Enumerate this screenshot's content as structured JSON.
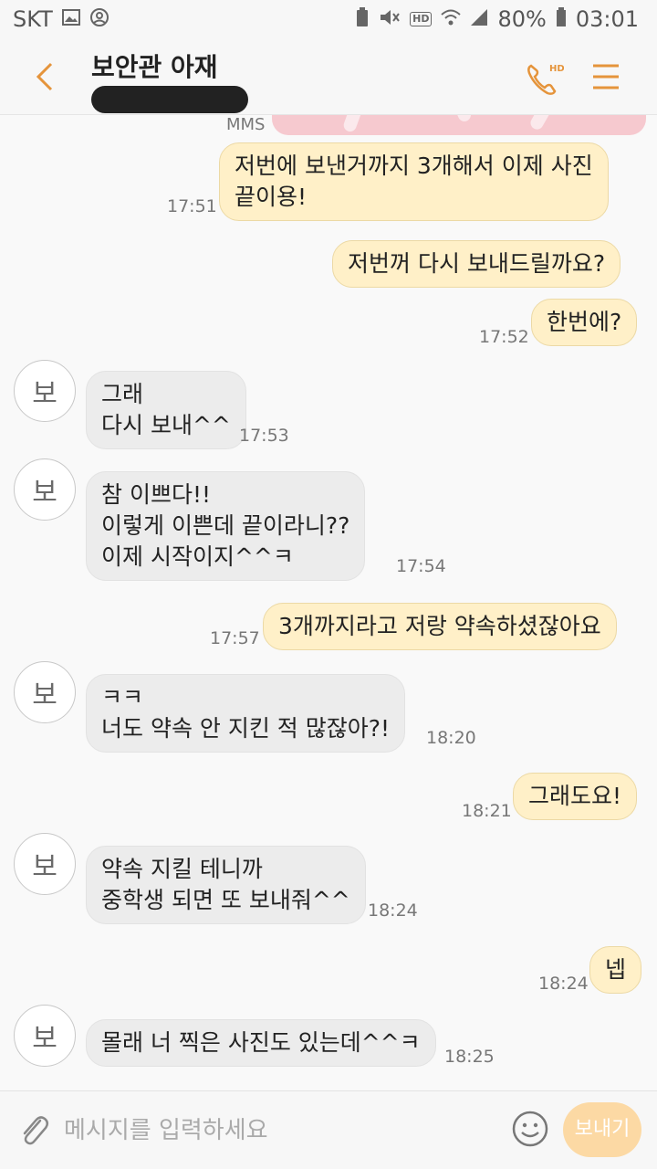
{
  "status_bar": {
    "carrier": "SKT",
    "hd_voice": "HD",
    "battery": "80%",
    "clock": "03:01",
    "icons": [
      "gallery-icon",
      "sync-icon",
      "battery-saver-icon",
      "mute-icon",
      "hd-voice-icon",
      "wifi-icon",
      "signal-icon",
      "battery-icon"
    ]
  },
  "header": {
    "contact_name": "보안관 아재",
    "icons": [
      "back-arrow-icon",
      "hd-call-icon",
      "menu-icon"
    ]
  },
  "messages": {
    "mms_label": "MMS",
    "items": [
      {
        "dir": "out",
        "lines": [
          "저번에 보낸거까지 3개해서 이제 사진",
          "끝이용!"
        ],
        "time": "17:51"
      },
      {
        "dir": "out",
        "lines": [
          "저번꺼 다시 보내드릴까요?"
        ],
        "time": ""
      },
      {
        "dir": "out",
        "lines": [
          "한번에?"
        ],
        "time": "17:52"
      },
      {
        "dir": "in",
        "avatar": "보",
        "lines": [
          "그래",
          "다시 보내^^"
        ],
        "time": "17:53"
      },
      {
        "dir": "in",
        "avatar": "보",
        "lines": [
          "참 이쁘다!!",
          "이렇게 이쁜데 끝이라니??",
          "이제 시작이지^^ㅋ"
        ],
        "time": "17:54"
      },
      {
        "dir": "out",
        "lines": [
          "3개까지라고 저랑 약속하셨잖아요"
        ],
        "time": "17:57"
      },
      {
        "dir": "in",
        "avatar": "보",
        "lines": [
          "ㅋㅋ",
          "너도 약속 안 지킨 적 많잖아?!"
        ],
        "time": "18:20"
      },
      {
        "dir": "out",
        "lines": [
          "그래도요!"
        ],
        "time": "18:21"
      },
      {
        "dir": "in",
        "avatar": "보",
        "lines": [
          "약속 지킬 테니까",
          "중학생 되면 또 보내줘^^"
        ],
        "time": "18:24"
      },
      {
        "dir": "out",
        "lines": [
          "넵"
        ],
        "time": "18:24"
      },
      {
        "dir": "in",
        "avatar": "보",
        "lines": [
          "몰래 너 찍은 사진도 있는데^^ㅋ"
        ],
        "time": "18:25"
      }
    ]
  },
  "input_bar": {
    "placeholder": "메시지를 입력하세요",
    "send_label": "보내기",
    "icons": [
      "paperclip-icon",
      "emoji-icon"
    ]
  },
  "colors": {
    "accent": "#e5943b",
    "outgoing_bubble": "#fff0c8",
    "incoming_bubble": "#ececec",
    "send_button": "#fcd9a4"
  }
}
